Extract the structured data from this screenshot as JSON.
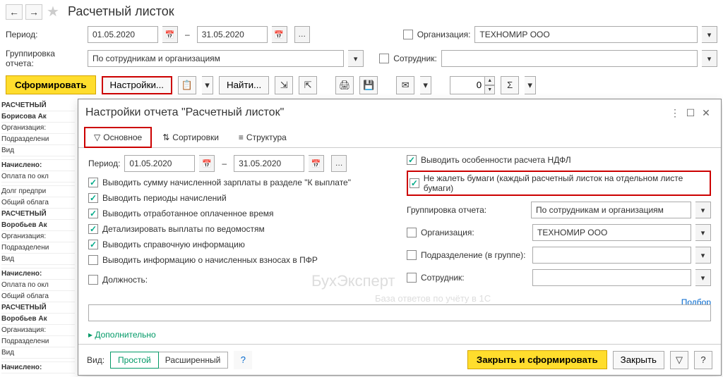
{
  "header": {
    "title": "Расчетный листок"
  },
  "period": {
    "label": "Период:",
    "from": "01.05.2020",
    "dash": "–",
    "to": "31.05.2020"
  },
  "org": {
    "label": "Организация:",
    "value": "ТЕХНОМИР ООО"
  },
  "grouping": {
    "label": "Группировка отчета:",
    "value": "По сотрудникам и организациям"
  },
  "employee": {
    "label": "Сотрудник:",
    "value": ""
  },
  "toolbar": {
    "form": "Сформировать",
    "settings": "Настройки...",
    "find": "Найти...",
    "spinner": "0"
  },
  "bg": [
    "РАСЧЕТНЫЙ",
    "Борисова Ак",
    "Организация:",
    "Подразделени",
    "Вид",
    "",
    "Начислено:",
    "Оплата по окл",
    "",
    "Долг предпри",
    "Общий облага",
    "РАСЧЕТНЫЙ",
    "Воробьев Ак",
    "Организация:",
    "Подразделени",
    "Вид",
    "",
    "Начислено:",
    "Оплата по окл",
    "Общий облага",
    "РАСЧЕТНЫЙ",
    "Воробьев Ак",
    "Организация:",
    "Подразделени",
    "Вид",
    "",
    "Начислено:"
  ],
  "dialog": {
    "title": "Настройки отчета \"Расчетный листок\"",
    "tabs": {
      "main": "Основное",
      "sort": "Сортировки",
      "struct": "Структура"
    },
    "period_label": "Период:",
    "from": "01.05.2020",
    "to": "31.05.2020",
    "checks_left": [
      "Выводить сумму начисленной зарплаты в разделе \"К выплате\"",
      "Выводить периоды начислений",
      "Выводить отработанное оплаченное время",
      "Детализировать выплаты по ведомостям",
      "Выводить справочную информацию",
      "Выводить информацию о начисленных взносах в ПФР"
    ],
    "check_ndfl": "Выводить особенности расчета НДФЛ",
    "check_paper": "Не жалеть бумаги (каждый расчетный листок на отдельном листе бумаги)",
    "group_label": "Группировка отчета:",
    "group_value": "По сотрудникам и организациям",
    "org_label": "Организация:",
    "org_value": "ТЕХНОМИР ООО",
    "subdiv_label": "Подразделение (в группе):",
    "emp_label": "Сотрудник:",
    "pos_label": "Должность:",
    "select_link": "Подбор",
    "more": "Дополнительно",
    "footer": {
      "view": "Вид:",
      "simple": "Простой",
      "advanced": "Расширенный",
      "close_form": "Закрыть и сформировать",
      "close": "Закрыть"
    }
  }
}
